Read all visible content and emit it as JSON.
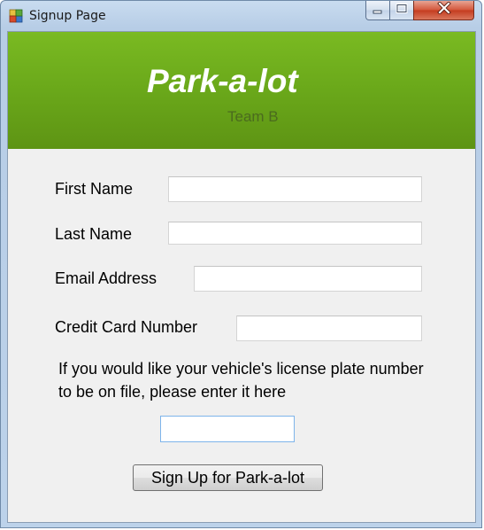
{
  "window": {
    "title": "Signup Page",
    "app_icon": "windows-form-icon",
    "controls": {
      "minimize_icon": "minimize-icon",
      "maximize_icon": "maximize-icon",
      "close_icon": "close-icon"
    }
  },
  "banner": {
    "title": "Park-a-lot",
    "subtitle": "Team B",
    "color": "#6aa81a"
  },
  "form": {
    "first_name": {
      "label": "First Name",
      "value": ""
    },
    "last_name": {
      "label": "Last Name",
      "value": ""
    },
    "email": {
      "label": "Email Address",
      "value": ""
    },
    "credit_card": {
      "label": "Credit Card Number",
      "value": ""
    },
    "license_plate": {
      "instructions": "If you would like your vehicle's license plate number to be on file, please enter it here",
      "value": ""
    },
    "submit_label": "Sign Up for Park-a-lot"
  }
}
